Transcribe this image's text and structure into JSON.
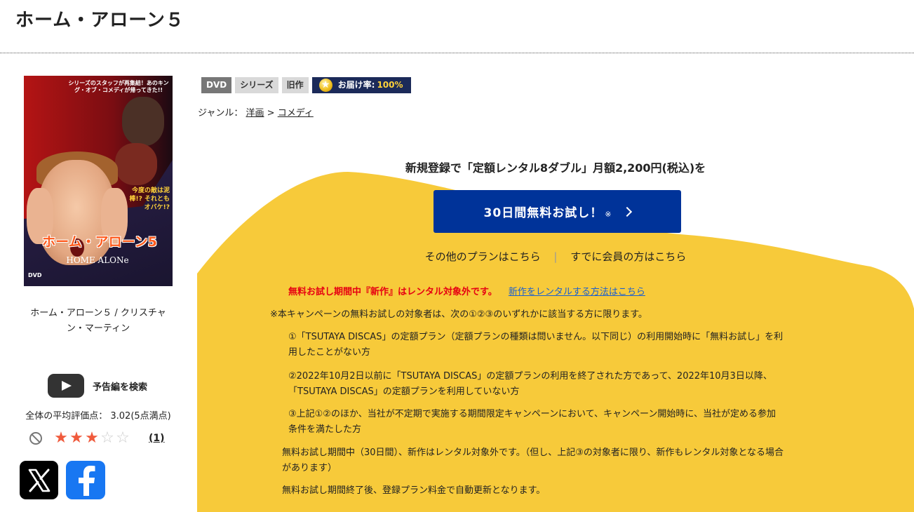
{
  "page": {
    "title": "ホーム・アローン５"
  },
  "cover": {
    "tagline": "シリーズのスタッフが再集結！あのキング・オブ・コメディが帰ってきた!!",
    "side_text": "今度の敵は泥棒!? それともオバケ!?",
    "logo_jp": "ホーム・アローン5",
    "logo_en": "HOME ALONe",
    "dvd_mark": "DVD"
  },
  "product": {
    "caption": "ホーム・アローン５ / クリスチャン・マーティン",
    "trailer_label": "予告編を検索",
    "avg_rating_text": "全体の平均評価点： 3.02(5点満点)",
    "rating_value": 3.02,
    "stars_filled": 3,
    "stars_total": 5,
    "review_count": "(1)"
  },
  "badges": {
    "dvd": "DVD",
    "series": "シリーズ",
    "old": "旧作",
    "delivery_label": "お届け率:",
    "delivery_rate": "100%"
  },
  "genre": {
    "label": "ジャンル：",
    "level1": "洋画",
    "separator": ">",
    "level2": "コメディ"
  },
  "campaign": {
    "headline": "新規登録で「定額レンタル8ダブル」月額2,200円(税込)を",
    "cta_label": "30日間無料お試し！",
    "cta_mark": "※",
    "other_plans": "その他のプランはこちら",
    "divider": "|",
    "member_login": "すでに会員の方はこちら",
    "notice_red": "無料お試し期間中『新作』はレンタル対象外です。",
    "notice_link": "新作をレンタルする方法はこちら",
    "terms_intro": "※本キャンペーンの無料お試しの対象者は、次の①②③のいずれかに該当する方に限ります。",
    "term1_line1": "①「TSUTAYA DISCAS」の定額プラン（定額プランの種類は問いません。以下同じ）の利用開始時に「無料お試し」を利",
    "term1_line2": "用したことがない方",
    "term2_line1": "②2022年10月2日以前に「TSUTAYA DISCAS」の定額プランの利用を終了された方であって、2022年10月3日以降、",
    "term2_line2": "「TSUTAYA DISCAS」の定額プランを利用していない方",
    "term3_line1": "③上記①②のほか、当社が不定期で実施する期間限定キャンペーンにおいて、キャンペーン開始時に、当社が定める参加",
    "term3_line2": "条件を満たした方",
    "note1_line1": "無料お試し期間中（30日間）、新作はレンタル対象外です。（但し、上記③の対象者に限り、新作もレンタル対象となる場合",
    "note1_line2": "があります）",
    "note2": "無料お試し期間終了後、登録プラン料金で自動更新となります。"
  },
  "colors": {
    "accent_yellow": "#f7ca3a",
    "cta_blue": "#003399",
    "notice_red": "#e60012",
    "link_blue": "#1a5fd0",
    "badge_navy": "#1b2a59",
    "star_red": "#f05a3c"
  },
  "icons": {
    "trailer": "play-icon",
    "no_rating": "no-entry-icon",
    "x": "x-logo-icon",
    "facebook": "facebook-logo-icon",
    "cta": "chevron-right-icon",
    "delivery": "star-icon"
  }
}
